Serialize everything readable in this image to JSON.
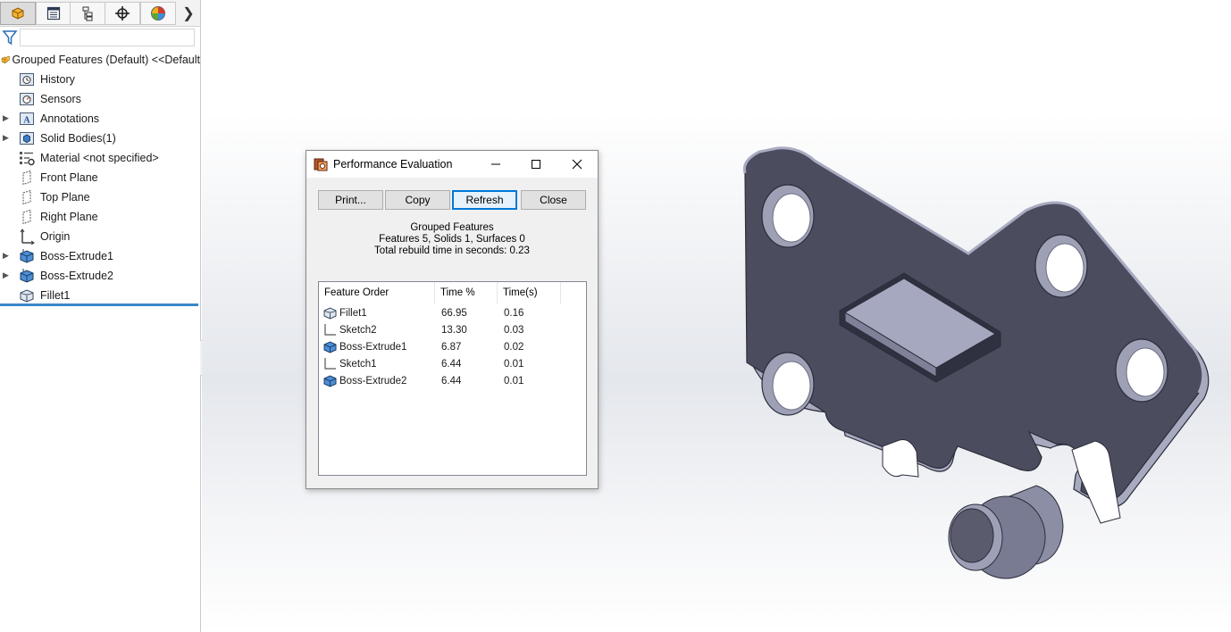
{
  "feature_manager": {
    "tabs": [
      {
        "icon": "feature-tree-icon",
        "active": true
      },
      {
        "icon": "property-manager-icon",
        "active": false
      },
      {
        "icon": "configuration-manager-icon",
        "active": false
      },
      {
        "icon": "dimxpert-manager-icon",
        "active": false
      },
      {
        "icon": "display-manager-icon",
        "active": false
      }
    ],
    "filter_placeholder": "",
    "root_label": "Grouped Features (Default) <<Default",
    "items": [
      {
        "label": "History",
        "icon": "history-folder-icon",
        "expandable": false
      },
      {
        "label": "Sensors",
        "icon": "sensors-folder-icon",
        "expandable": false
      },
      {
        "label": "Annotations",
        "icon": "annotations-folder-icon",
        "expandable": true
      },
      {
        "label": "Solid Bodies(1)",
        "icon": "solid-bodies-folder-icon",
        "expandable": true
      },
      {
        "label": "Material <not specified>",
        "icon": "material-icon",
        "expandable": false
      },
      {
        "label": "Front Plane",
        "icon": "plane-icon",
        "expandable": false
      },
      {
        "label": "Top Plane",
        "icon": "plane-icon",
        "expandable": false
      },
      {
        "label": "Right Plane",
        "icon": "plane-icon",
        "expandable": false
      },
      {
        "label": "Origin",
        "icon": "origin-icon",
        "expandable": false
      },
      {
        "label": "Boss-Extrude1",
        "icon": "boss-extrude-icon",
        "expandable": true
      },
      {
        "label": "Boss-Extrude2",
        "icon": "boss-extrude-icon",
        "expandable": true
      },
      {
        "label": "Fillet1",
        "icon": "fillet-icon",
        "expandable": false
      }
    ]
  },
  "dialog": {
    "title": "Performance Evaluation",
    "buttons": {
      "print": "Print...",
      "copy": "Copy",
      "refresh": "Refresh",
      "close": "Close"
    },
    "summary": {
      "part_name": "Grouped Features",
      "counts": "Features 5, Solids 1, Surfaces 0",
      "rebuild_time": "Total rebuild time in seconds: 0.23"
    },
    "columns": {
      "feature_order": "Feature Order",
      "time_pct": "Time %",
      "time_s": "Time(s)"
    },
    "rows": [
      {
        "name": "Fillet1",
        "pct": "66.95",
        "time": "0.16",
        "icon": "fillet-icon"
      },
      {
        "name": "Sketch2",
        "pct": "13.30",
        "time": "0.03",
        "icon": "sketch-icon"
      },
      {
        "name": "Boss-Extrude1",
        "pct": "6.87",
        "time": "0.02",
        "icon": "boss-extrude-icon"
      },
      {
        "name": "Sketch1",
        "pct": "6.44",
        "time": "0.01",
        "icon": "sketch-icon"
      },
      {
        "name": "Boss-Extrude2",
        "pct": "6.44",
        "time": "0.01",
        "icon": "boss-extrude-icon"
      }
    ]
  },
  "colors": {
    "accent": "#0078d7",
    "rollback_bar": "#3a86c8",
    "part_face": "#4b4d5e",
    "part_edge": "#a9abc2"
  }
}
